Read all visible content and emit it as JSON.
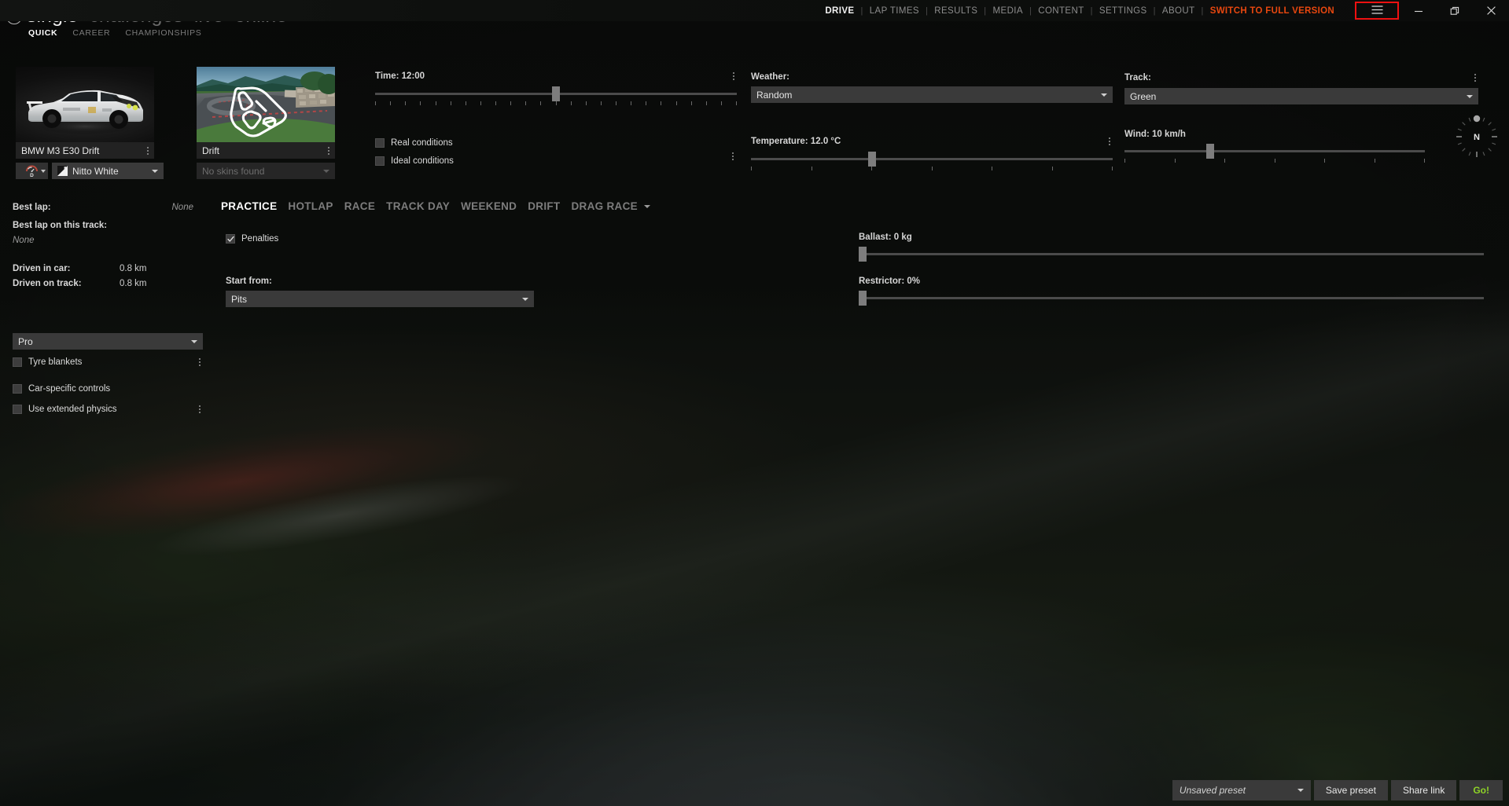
{
  "titlebar": {
    "menu_icon": "hamburger-icon",
    "minimize_icon": "minimize-icon",
    "restore_icon": "restore-icon",
    "close_icon": "close-icon",
    "highlight_color": "#ee1111"
  },
  "topnav": {
    "items": [
      {
        "label": "DRIVE",
        "active": true
      },
      {
        "label": "LAP TIMES",
        "active": false
      },
      {
        "label": "RESULTS",
        "active": false
      },
      {
        "label": "MEDIA",
        "active": false
      },
      {
        "label": "CONTENT",
        "active": false
      },
      {
        "label": "SETTINGS",
        "active": false
      },
      {
        "label": "ABOUT",
        "active": false
      }
    ],
    "separator": "|",
    "switch_label": "SWITCH TO FULL VERSION",
    "switch_color": "#e8470f"
  },
  "header": {
    "back_icon": "back-arrow-icon",
    "main_tabs": [
      {
        "label": "single",
        "active": true
      },
      {
        "label": "challenges",
        "active": false
      },
      {
        "label": "live",
        "active": false
      },
      {
        "label": "online",
        "active": false
      }
    ],
    "sub_tabs": [
      {
        "label": "QUICK",
        "active": true
      },
      {
        "label": "CAREER",
        "active": false
      },
      {
        "label": "CHAMPIONSHIPS",
        "active": false
      }
    ]
  },
  "car_panel": {
    "name": "BMW M3 E30 Drift",
    "menu_icon": "more-vertical-icon",
    "drivetrain_badge": "D",
    "skin": "Nitto White",
    "skin_caret": "chevron-down-icon"
  },
  "track_panel": {
    "name": "Drift",
    "menu_icon": "more-vertical-icon",
    "layout_placeholder": "No skins found"
  },
  "stats": {
    "best_lap_label": "Best lap:",
    "best_lap_value": "None",
    "best_lap_track_label": "Best lap on this track:",
    "best_lap_track_value": "None",
    "driven_car_label": "Driven in car:",
    "driven_car_value": "0.8 km",
    "driven_track_label": "Driven on track:",
    "driven_track_value": "0.8 km"
  },
  "assists": {
    "preset": "Pro",
    "tyre_blankets": {
      "label": "Tyre blankets",
      "checked": false,
      "menu_icon": "more-vertical-icon"
    },
    "car_specific_controls": {
      "label": "Car-specific controls",
      "checked": false
    },
    "extended_physics": {
      "label": "Use extended physics",
      "checked": false,
      "menu_icon": "more-vertical-icon"
    }
  },
  "session": {
    "tabs": [
      {
        "label": "PRACTICE",
        "active": true
      },
      {
        "label": "HOTLAP",
        "active": false
      },
      {
        "label": "RACE",
        "active": false
      },
      {
        "label": "TRACK DAY",
        "active": false
      },
      {
        "label": "WEEKEND",
        "active": false
      },
      {
        "label": "DRIFT",
        "active": false
      },
      {
        "label": "DRAG RACE",
        "active": false
      }
    ],
    "more_caret": "chevron-down-icon",
    "penalties": {
      "label": "Penalties",
      "checked": true
    },
    "start_from_label": "Start from:",
    "start_from_value": "Pits"
  },
  "conditions": {
    "time_label": "Time: 12:00",
    "time_percent": 50,
    "time_menu_icon": "more-vertical-icon",
    "real_conditions": {
      "label": "Real conditions",
      "checked": false
    },
    "ideal_conditions": {
      "label": "Ideal conditions",
      "checked": false
    },
    "conditions_menu_icon": "more-vertical-icon",
    "weather_label": "Weather:",
    "weather_value": "Random",
    "temperature_label": "Temperature: 12.0 °C",
    "temperature_percent": 33,
    "temperature_menu_icon": "more-vertical-icon",
    "track_label": "Track:",
    "track_value": "Green",
    "track_menu_icon": "more-vertical-icon",
    "wind_label": "Wind: 10 km/h",
    "wind_percent": 28,
    "wind_direction": "N"
  },
  "tuning": {
    "ballast_label": "Ballast: 0 kg",
    "ballast_percent": 0,
    "restrictor_label": "Restrictor: 0%",
    "restrictor_percent": 0
  },
  "bottombar": {
    "preset_value": "Unsaved preset",
    "preset_caret": "chevron-down-icon",
    "save_preset": "Save preset",
    "share_link": "Share link",
    "go": "Go!",
    "go_color": "#8ed327"
  }
}
